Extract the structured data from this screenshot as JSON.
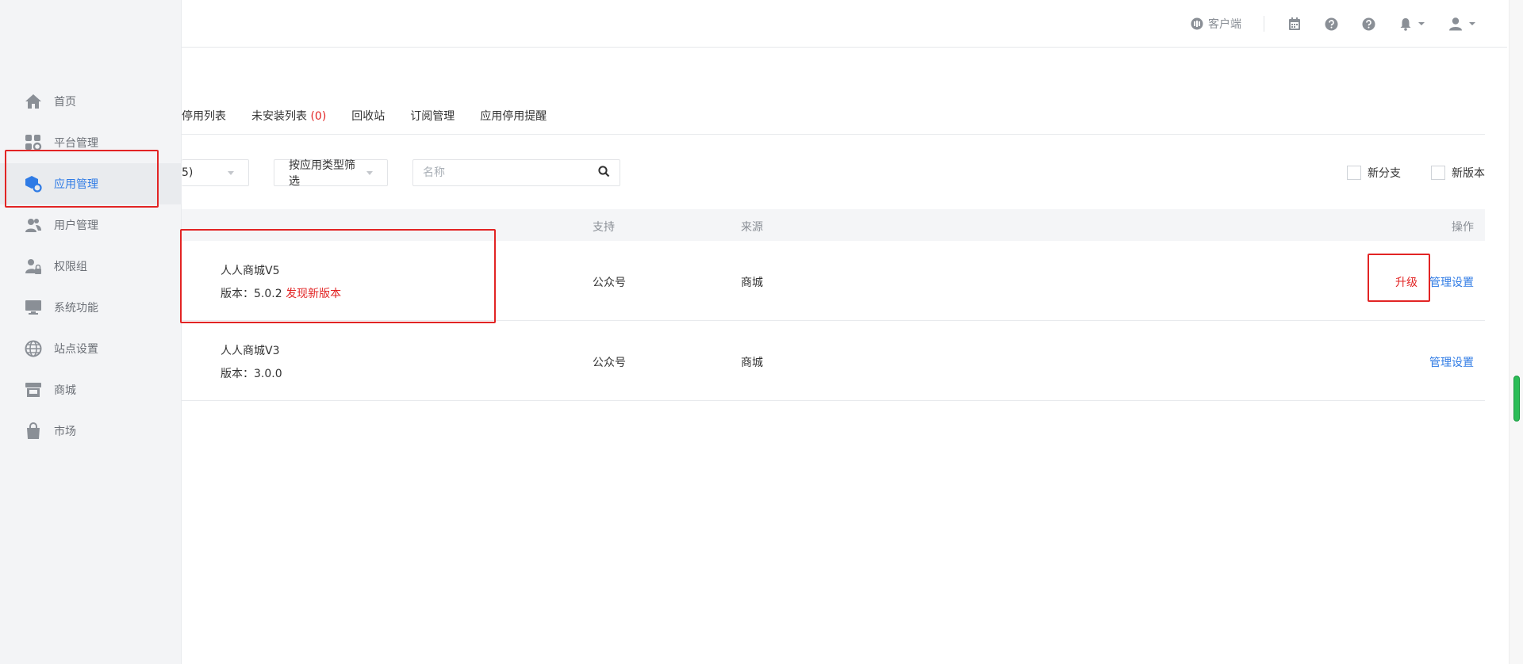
{
  "topbar": {
    "client_label": "客户端"
  },
  "sidebar": {
    "items": [
      {
        "label": "首页",
        "icon": "home-icon"
      },
      {
        "label": "平台管理",
        "icon": "grid-gear-icon"
      },
      {
        "label": "应用管理",
        "icon": "cube-gear-icon",
        "active": true
      },
      {
        "label": "用户管理",
        "icon": "users-icon"
      },
      {
        "label": "权限组",
        "icon": "user-lock-icon"
      },
      {
        "label": "系统功能",
        "icon": "monitor-icon"
      },
      {
        "label": "站点设置",
        "icon": "globe-icon"
      },
      {
        "label": "商城",
        "icon": "store-icon"
      },
      {
        "label": "市场",
        "icon": "shopping-bag-icon"
      }
    ]
  },
  "tabs": [
    {
      "label": "停用列表"
    },
    {
      "label": "未安装列表",
      "count": "(0)"
    },
    {
      "label": "回收站"
    },
    {
      "label": "订阅管理"
    },
    {
      "label": "应用停用提醒"
    }
  ],
  "filters": {
    "select1_value": "5)",
    "select2_value": "按应用类型筛选",
    "search_placeholder": "名称",
    "check_new_branch": "新分支",
    "check_new_version": "新版本"
  },
  "table": {
    "headers": {
      "support": "支持",
      "source": "来源",
      "actions": "操作"
    },
    "rows": [
      {
        "name": "人人商城V5",
        "version_label": "版本：5.0.2",
        "new_version": "发现新版本",
        "support": "公众号",
        "source": "商城",
        "upgrade": "升级",
        "manage": "管理设置"
      },
      {
        "name": "人人商城V3",
        "version_label": "版本：3.0.0",
        "support": "公众号",
        "source": "商城",
        "manage": "管理设置"
      }
    ]
  },
  "colors": {
    "accent": "#2f7be5",
    "danger": "#e22424",
    "sidebar_bg": "#f3f4f6"
  }
}
